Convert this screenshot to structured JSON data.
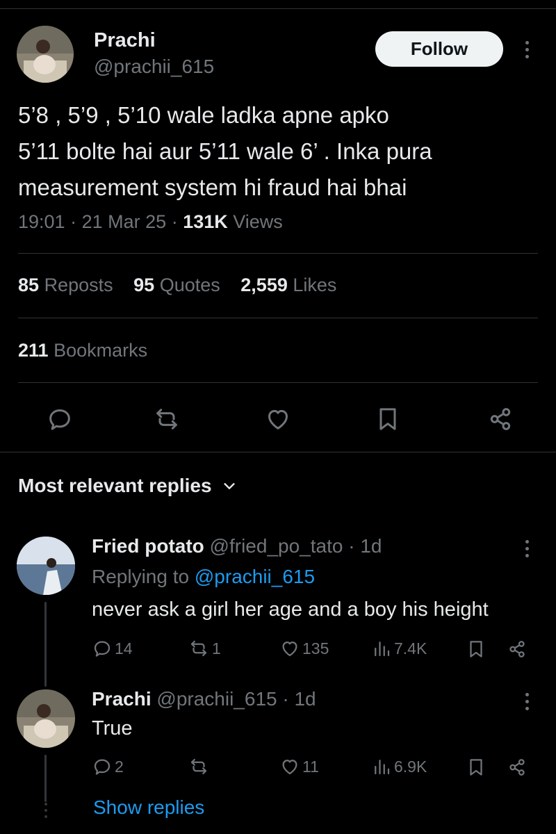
{
  "tweet": {
    "author_name": "Prachi",
    "author_handle": "@prachii_615",
    "follow_label": "Follow",
    "text": "5’8 , 5’9 , 5’10 wale ladka apne apko\n5’11 bolte hai aur 5’11 wale 6’ . Inka pura\nmeasurement system hi fraud  hai bhai",
    "time": "19:01",
    "date": "21 Mar 25",
    "views_count": "131K",
    "views_label": "Views",
    "reposts_count": "85",
    "reposts_label": "Reposts",
    "quotes_count": "95",
    "quotes_label": "Quotes",
    "likes_count": "2,559",
    "likes_label": "Likes",
    "bookmarks_count": "211",
    "bookmarks_label": "Bookmarks",
    "actions": [
      "reply-icon",
      "repost-icon",
      "like-icon",
      "bookmark-icon",
      "share-icon"
    ]
  },
  "replies_section": {
    "title": "Most relevant replies",
    "icon": "chevron-down-icon"
  },
  "replies": [
    {
      "name": "Fried potato",
      "handle": "@fried_po_tato",
      "age": "· 1d",
      "replying_prefix": "Replying to",
      "replying_handle": "@prachii_615",
      "text": "never ask a girl her age and a boy his height",
      "replies": "14",
      "reposts": "1",
      "likes": "135",
      "views": "7.4K"
    },
    {
      "name": "Prachi",
      "handle": "@prachii_615",
      "age": "· 1d",
      "text": "True",
      "replies": "2",
      "reposts": "",
      "likes": "11",
      "views": "6.9K"
    }
  ],
  "show_replies_label": "Show replies",
  "colors": {
    "background": "#000000",
    "text": "#e7e9ea",
    "muted": "#71767b",
    "link": "#1d9bf0",
    "divider": "#2f3336"
  }
}
